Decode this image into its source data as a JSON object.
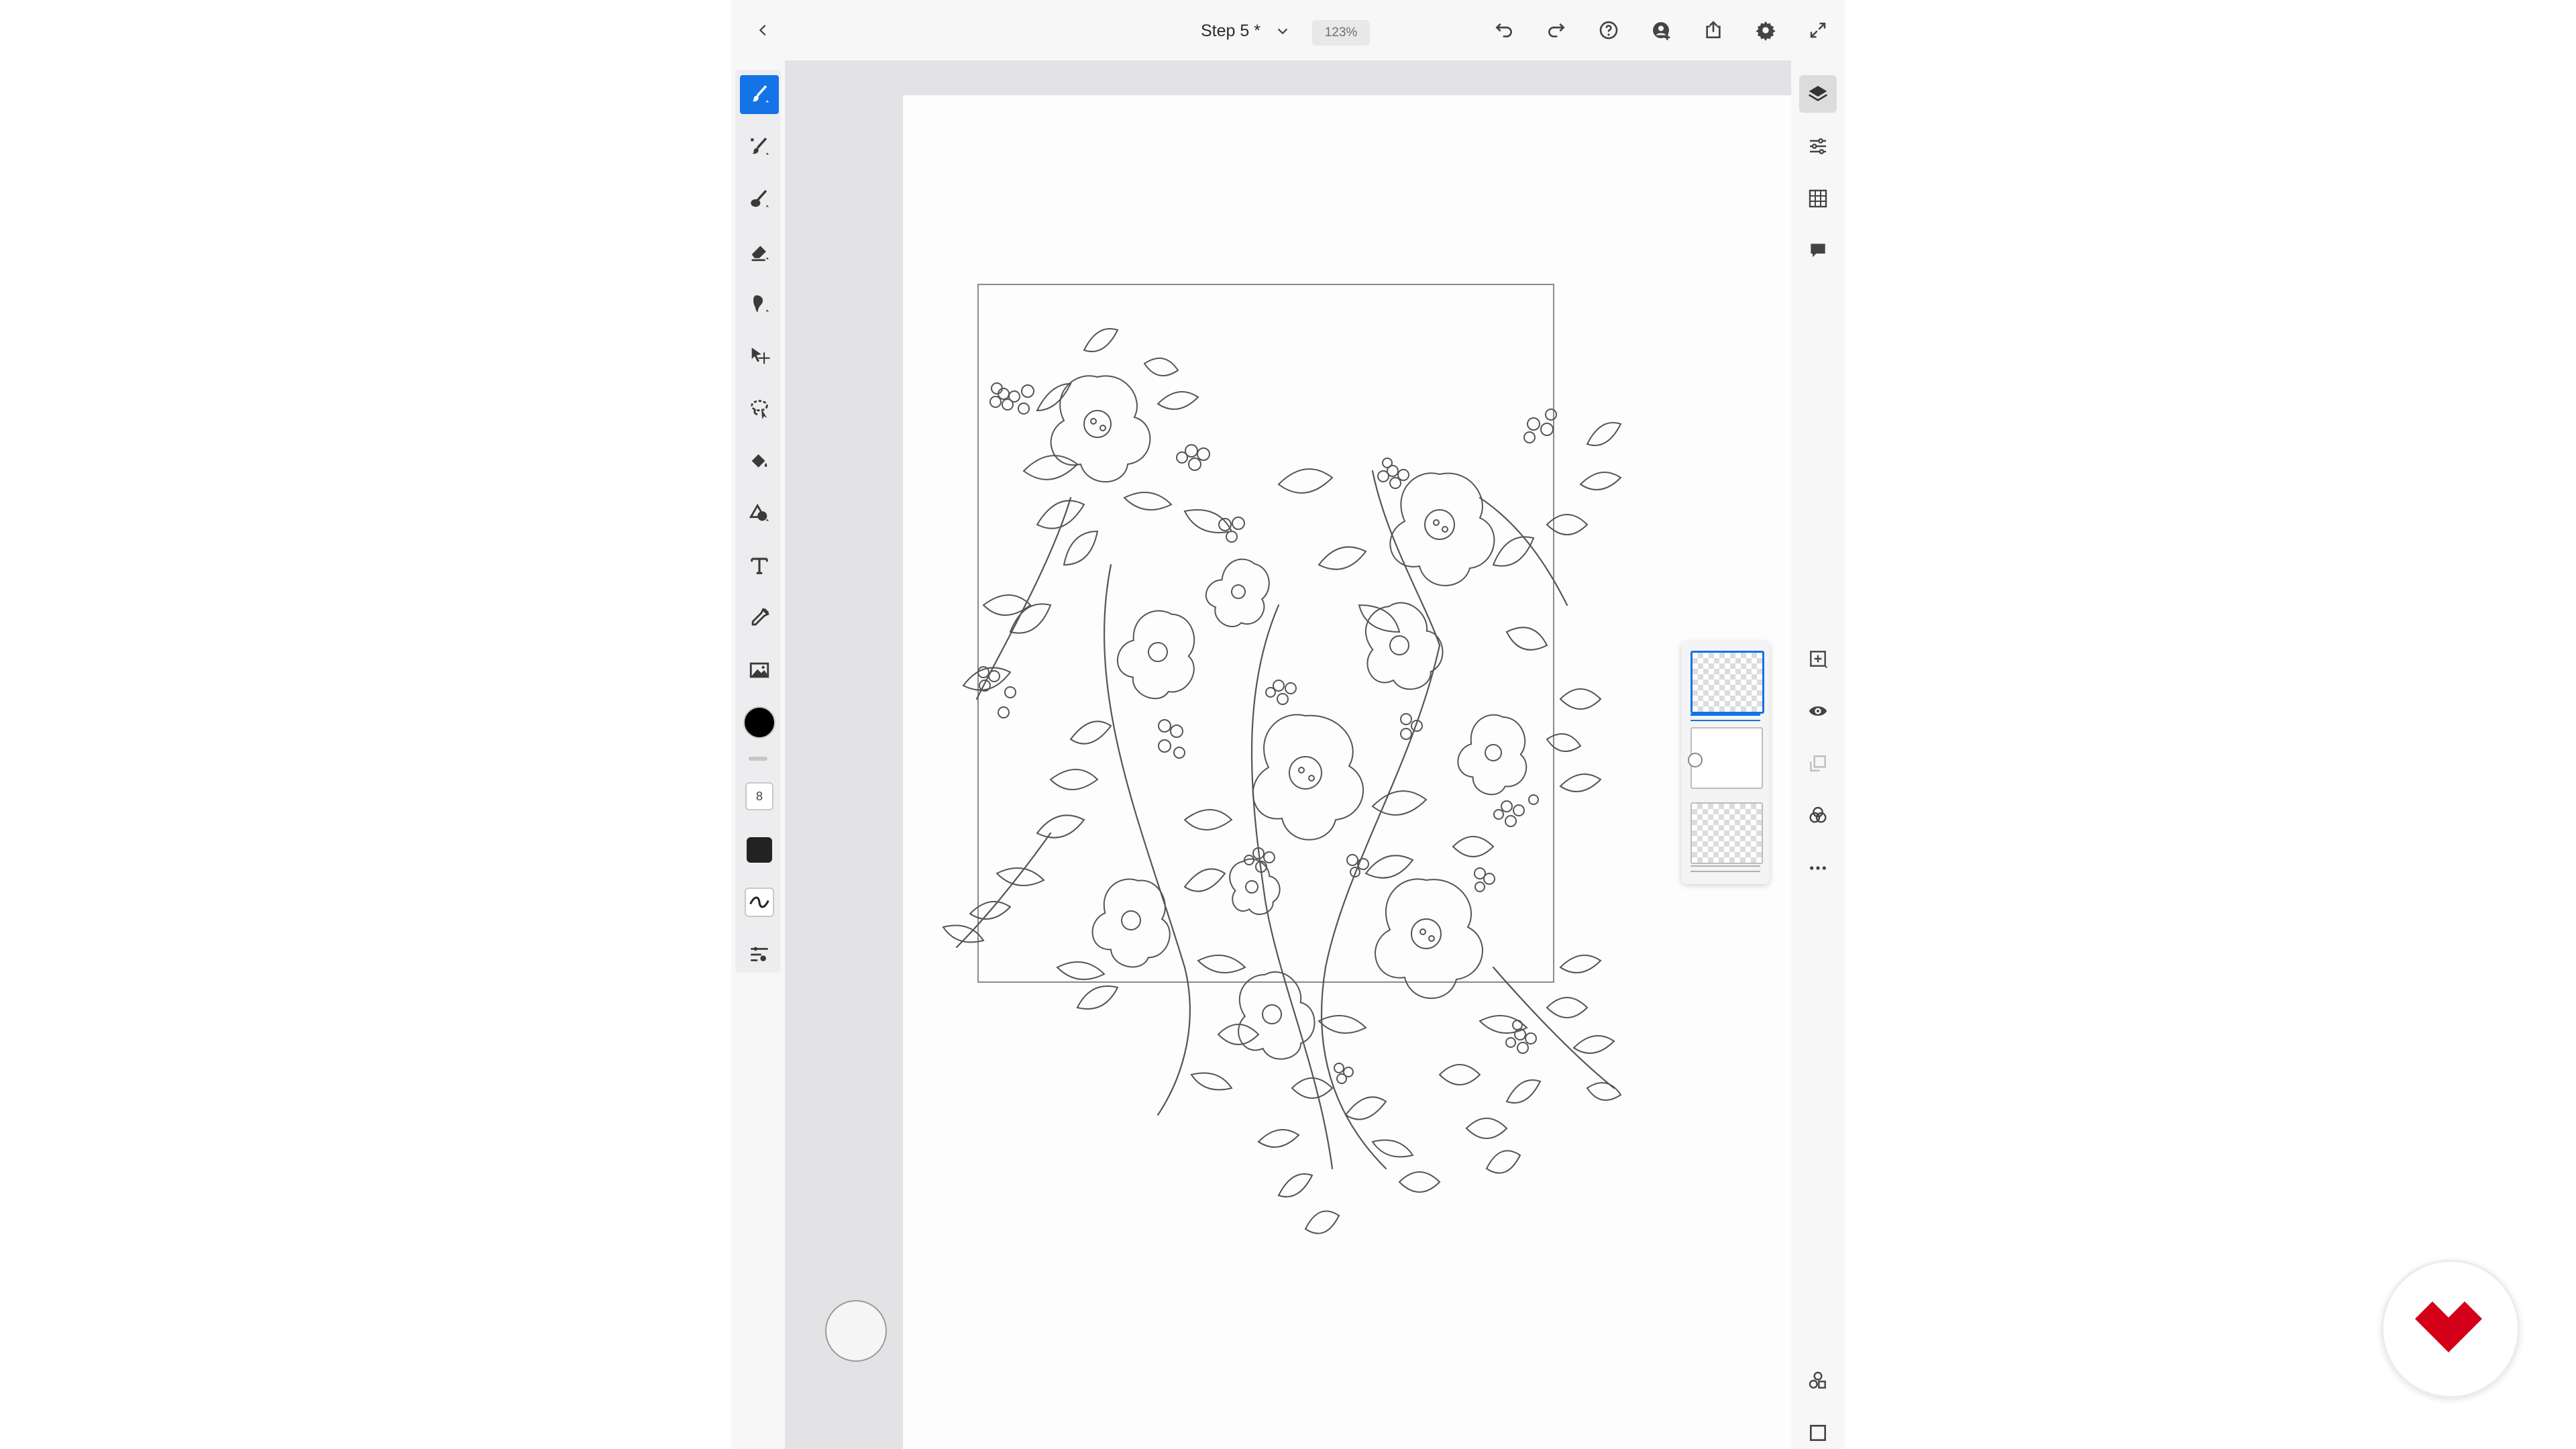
{
  "topbar": {
    "title": "Step 5 *",
    "zoom": "123%"
  },
  "left_toolbar": {
    "tools": [
      "paint-brush",
      "pixel-brush",
      "watercolor-brush",
      "eraser",
      "smudge",
      "move-transform",
      "lasso-select",
      "fill",
      "shape",
      "text",
      "eyedropper",
      "image"
    ],
    "brush_size": "8",
    "active_tool": "paint-brush"
  },
  "right_toolbar": {
    "top": [
      "layers",
      "properties",
      "grid",
      "comments"
    ],
    "layer_actions": [
      "add-layer",
      "visibility",
      "mask",
      "blend",
      "more"
    ],
    "bottom": [
      "shapes",
      "fullscreen-toggle"
    ]
  },
  "layers_panel": {
    "layer_count": 3,
    "selected_index": 0
  },
  "colors": {
    "accent": "#1473e6",
    "current_color": "#000000",
    "toolbar_bg": "#f7f7f8",
    "canvas_gray": "#e3e3e5",
    "logo_red": "#d4001a"
  },
  "logo": {
    "icon": "brand-logo-icon"
  }
}
